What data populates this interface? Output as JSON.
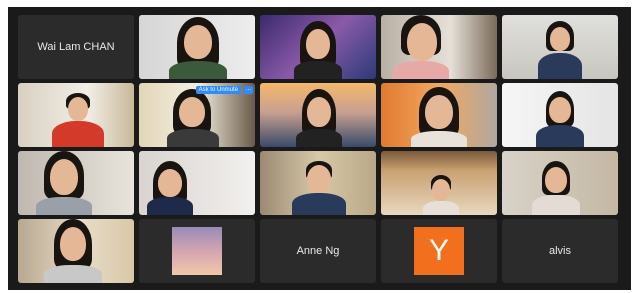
{
  "participants": [
    {
      "name": "Wai Lam CHAN",
      "video": false
    },
    {
      "name": "",
      "video": true
    },
    {
      "name": "",
      "video": true
    },
    {
      "name": "",
      "video": true
    },
    {
      "name": "",
      "video": true
    },
    {
      "name": "",
      "video": true
    },
    {
      "name": "",
      "video": true,
      "overlay": {
        "unmute_label": "Ask to Unmute",
        "more_label": "..."
      }
    },
    {
      "name": "",
      "video": true
    },
    {
      "name": "",
      "video": true
    },
    {
      "name": "",
      "video": true
    },
    {
      "name": "",
      "video": true
    },
    {
      "name": "",
      "video": true
    },
    {
      "name": "",
      "video": true
    },
    {
      "name": "",
      "video": true
    },
    {
      "name": "",
      "video": true
    },
    {
      "name": "",
      "video": true
    },
    {
      "name": "",
      "video": true
    },
    {
      "name": "Anne Ng",
      "video": false
    },
    {
      "name": "",
      "video": false,
      "avatar_letter": "Y",
      "avatar_color": "#f26f1d"
    },
    {
      "name": "alvis",
      "video": false
    }
  ],
  "colors": {
    "active_speaker": "#3fbf4a",
    "unmute_badge": "#2d8cff",
    "window_bg": "#1a1a1a"
  }
}
